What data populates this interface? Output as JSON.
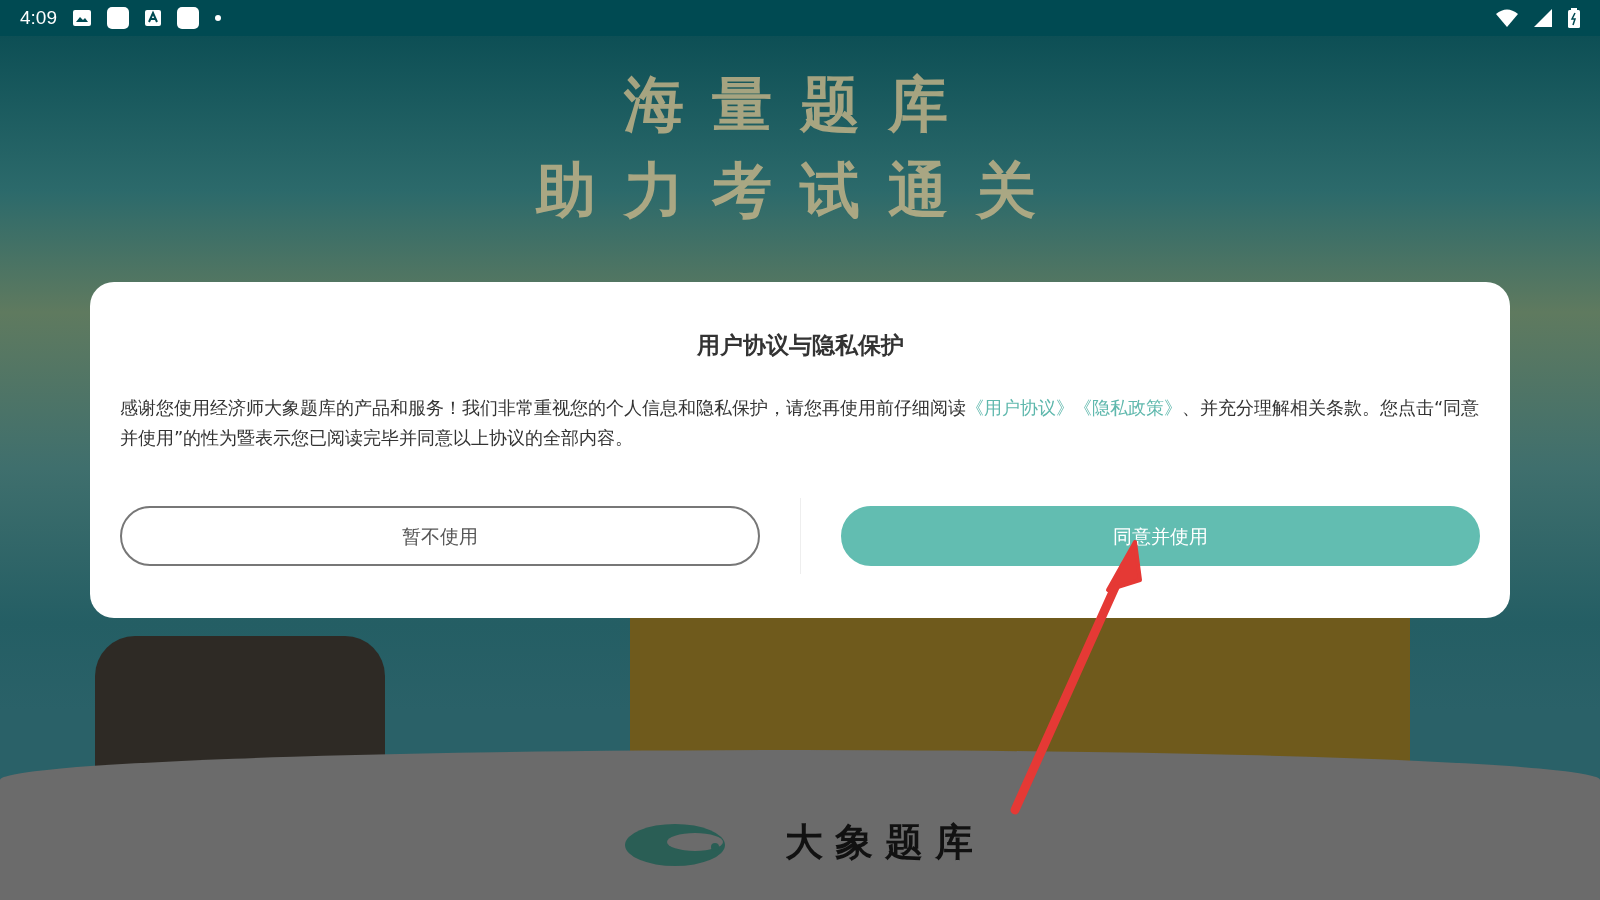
{
  "status_bar": {
    "time": "4:09"
  },
  "background": {
    "headline": [
      "海量题库",
      "助力考试通关"
    ],
    "brand": "大象题库"
  },
  "dialog": {
    "title": "用户协议与隐私保护",
    "body": {
      "before": "感谢您使用经济师大象题库的产品和服务！我们非常重视您的个人信息和隐私保护，请您再使用前仔细阅读",
      "links": [
        "《用户协议》",
        "《隐私政策》"
      ],
      "after": "、并充分理解相关条款。您点击“同意并使用”的性为暨表示您已阅读完毕并同意以上协议的全部内容。"
    },
    "buttons": [
      {
        "label": "暂不使用",
        "kind": "outline"
      },
      {
        "label": "同意并使用",
        "kind": "primary"
      }
    ]
  }
}
